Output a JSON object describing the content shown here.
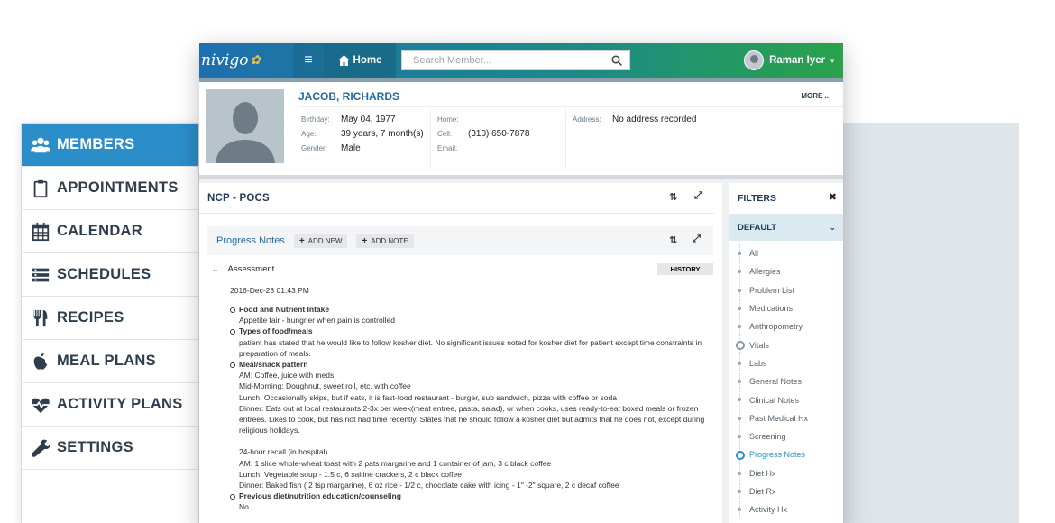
{
  "sidebar": {
    "items": [
      {
        "label": "MEMBERS",
        "icon": "users-icon",
        "active": true
      },
      {
        "label": "APPOINTMENTS",
        "icon": "clipboard-icon",
        "active": false
      },
      {
        "label": "CALENDAR",
        "icon": "calendar-icon",
        "active": false
      },
      {
        "label": "SCHEDULES",
        "icon": "list-icon",
        "active": false
      },
      {
        "label": "RECIPES",
        "icon": "utensils-icon",
        "active": false
      },
      {
        "label": "MEAL PLANS",
        "icon": "apple-icon",
        "active": false
      },
      {
        "label": "ACTIVITY PLANS",
        "icon": "heartbeat-icon",
        "active": false
      },
      {
        "label": "SETTINGS",
        "icon": "wrench-icon",
        "active": false
      }
    ],
    "accent_color": "#2b8ec9"
  },
  "topbar": {
    "logo": "nivigo",
    "home_label": "Home",
    "search_placeholder": "Search Member...",
    "user_name": "Raman Iyer"
  },
  "patient": {
    "name": "JACOB, RICHARDS",
    "more_label": "MORE ..",
    "birthday_label": "Birthday:",
    "birthday": "May 04, 1977",
    "age_label": "Age:",
    "age": "39 years, 7 month(s)",
    "gender_label": "Gender:",
    "gender": "Male",
    "home_label": "Home:",
    "home": "",
    "cell_label": "Cell:",
    "cell": "(310) 650-7878",
    "email_label": "Email:",
    "email": "",
    "address_label": "Address:",
    "address": "No address recorded"
  },
  "panel": {
    "title": "NCP - POCS",
    "progress_notes_label": "Progress Notes",
    "add_new_label": "ADD NEW",
    "add_note_label": "ADD NOTE",
    "section_label": "Assessment",
    "history_label": "HISTORY",
    "date": "2016-Dec-23 01:43 PM",
    "notes": {
      "h1": "Food and Nutrient Intake",
      "b1": "Appetite fair - hungrier when pain is controlled",
      "h2": "Types of food/meals",
      "b2": "patient has stated that he would like to follow kosher diet. No significant issues noted for kosher diet for patient except time constraints in preparation of meals.",
      "h3": "Meal/snack pattern",
      "b3a": "AM: Coffee, juice with meds",
      "b3b": "Mid-Morning: Doughnut, sweet roll, etc. with coffee",
      "b3c": "Lunch: Occasionally skips, but if eats, it is fast-food restaurant - burger, sub sandwich, pizza with coffee or soda",
      "b3d": "Dinner: Eats out at local restaurants 2-3x per week(meat entree, pasta, salad), or when cooks, uses ready-to-eat boxed meals or frozen entrees. Likes to cook, but has not had time recently. States that he should follow a kosher diet but admits that he does not, except during religious holidays.",
      "b4a": "24-hour recall (in hospital)",
      "b4b": "AM: 1 slice whole-wheat toast with 2 pats margarine and 1 container of jam, 3 c black coffee",
      "b4c": "Lunch: Vegetable soup - 1.5 c, 6 saltine crackers, 2 c black coffee",
      "b4d": "Dinner: Baked fish ( 2 tsp margarine), 6 oz rice - 1/2 c, chocolate cake with icing - 1\" -2\" square, 2 c decaf coffee",
      "h5": "Previous diet/nutrition education/counseling",
      "b5": "No"
    }
  },
  "filters": {
    "title": "FILTERS",
    "close": "✖",
    "group": "DEFAULT",
    "items": [
      "All",
      "Allergies",
      "Problem List",
      "Medications",
      "Anthropometry",
      "Vitals",
      "Labs",
      "General Notes",
      "Clinical Notes",
      "Past Medical Hx",
      "Screening",
      "Progress Notes",
      "Diet Hx",
      "Diet Rx",
      "Activity Hx"
    ],
    "selected": [
      "Vitals",
      "Progress Notes"
    ]
  }
}
